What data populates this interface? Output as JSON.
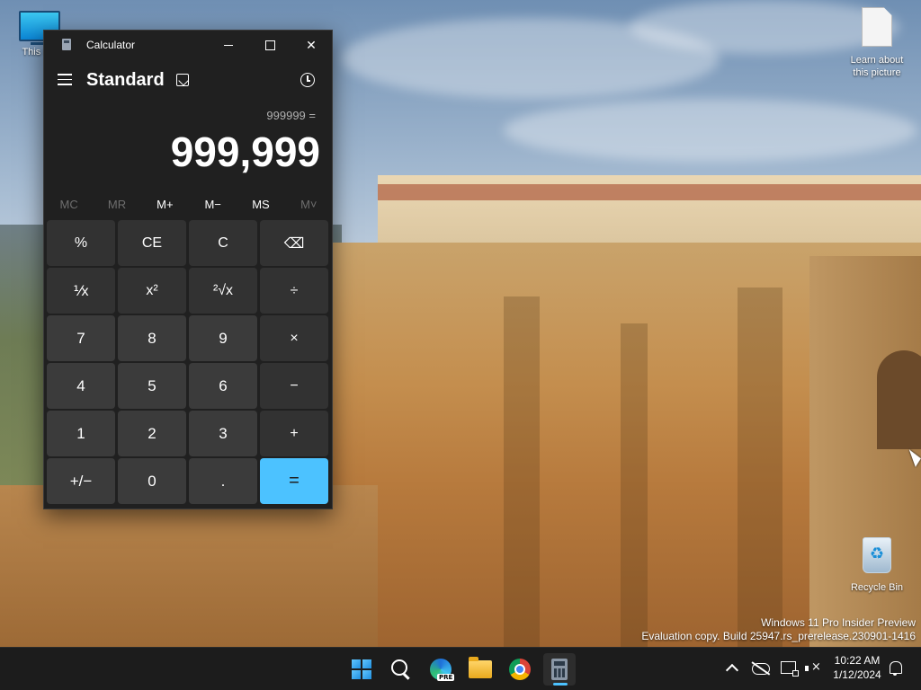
{
  "desktop": {
    "icons": [
      {
        "id": "this-pc",
        "label": "This PC"
      },
      {
        "id": "learn-picture",
        "label": "Learn about this picture"
      },
      {
        "id": "recycle-bin",
        "label": "Recycle Bin"
      }
    ],
    "watermark": {
      "line1": "Windows 11 Pro Insider Preview",
      "line2": "Evaluation copy. Build 25947.rs_prerelease.230901-1416"
    }
  },
  "calculator": {
    "window_title": "Calculator",
    "mode": "Standard",
    "expression": "999999 =",
    "result": "999,999",
    "memory": [
      {
        "label": "MC",
        "enabled": false
      },
      {
        "label": "MR",
        "enabled": false
      },
      {
        "label": "M+",
        "enabled": true
      },
      {
        "label": "M−",
        "enabled": true
      },
      {
        "label": "MS",
        "enabled": true
      },
      {
        "label": "M˅",
        "enabled": false
      }
    ],
    "keys": [
      [
        "%",
        "CE",
        "C",
        "⌫"
      ],
      [
        "⅟x",
        "x²",
        "²√x",
        "÷"
      ],
      [
        "7",
        "8",
        "9",
        "×"
      ],
      [
        "4",
        "5",
        "6",
        "−"
      ],
      [
        "1",
        "2",
        "3",
        "+"
      ],
      [
        "+/−",
        "0",
        ".",
        "="
      ]
    ]
  },
  "taskbar": {
    "apps": [
      {
        "id": "start",
        "icon": "windows-start-icon"
      },
      {
        "id": "search",
        "icon": "search-icon"
      },
      {
        "id": "edge-pre",
        "icon": "edge-icon",
        "badge": "PRE"
      },
      {
        "id": "file-explorer",
        "icon": "folder-icon"
      },
      {
        "id": "chrome",
        "icon": "chrome-icon"
      },
      {
        "id": "calculator",
        "icon": "calculator-icon",
        "active": true
      }
    ],
    "clock": {
      "time": "10:22 AM",
      "date": "1/12/2024"
    }
  },
  "colors": {
    "accent": "#4cc2ff",
    "calc_bg": "#202020",
    "key_num": "#3b3b3b",
    "key_fn": "#323232",
    "taskbar_bg": "#1c1c1c"
  }
}
